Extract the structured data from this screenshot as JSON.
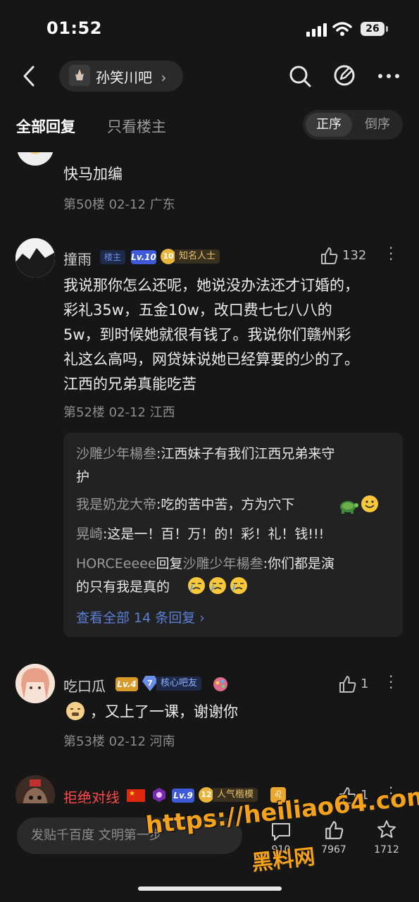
{
  "status_bar": {
    "time": "01:52",
    "battery": "26"
  },
  "nav": {
    "forum_name": "孙笑川吧",
    "chevron": "›"
  },
  "tabs": {
    "all": "全部回复",
    "op_only": "只看楼主",
    "sort_asc": "正序",
    "sort_desc": "倒序"
  },
  "posts": [
    {
      "text": "快马加编",
      "meta": "第50楼 02-12 广东"
    },
    {
      "name": "撞雨",
      "badges": {
        "role": "楼主",
        "level": "Lv.10",
        "title_num": "10",
        "title": "知名人士"
      },
      "likes": "132",
      "lines": [
        "我说那你怎么还呢，她说没办法还才订婚的，",
        "彩礼35w，五金10w，改口费七七八八的",
        "5w，到时候她就很有钱了。我说你们赣州彩",
        "礼这么高吗，网贷妹说她已经算要的少的了。",
        "江西的兄弟真能吃苦"
      ],
      "meta": "第52楼 02-12 江西",
      "replies": [
        {
          "who": "沙雕少年楊叁",
          "text1": ":江西妹子有我们江西兄弟来守",
          "text2": "护"
        },
        {
          "who": "我是奶龙大帝",
          "text1": ":吃的苦中苦，方为穴下"
        },
        {
          "who": "晃崎",
          "text1": ":这是一！百！万！的！彩！礼！钱!!!"
        },
        {
          "who": "HORCEeeee",
          "reply": "回复",
          "to": "沙雕少年楊叁",
          "text1": ":你们都是演",
          "text2": "的只有我是真的"
        }
      ],
      "view_all": "查看全部 14 条回复 ›"
    },
    {
      "name": "吃口瓜",
      "badges": {
        "level": "Lv.4",
        "title_num": "7",
        "title": "核心吧友"
      },
      "likes": "1",
      "text": "，又上了一课，谢谢你",
      "meta": "第53楼 02-12 河南"
    },
    {
      "name": "拒绝对线",
      "badges": {
        "level": "Lv.9",
        "title_num": "12",
        "title": "人气楷模"
      },
      "likes": "1"
    }
  ],
  "bottom_bar": {
    "input_placeholder": "发贴千百度 文明第一步",
    "comments": "910",
    "likes": "7967",
    "favorites": "1712"
  },
  "watermark": {
    "url": "https://heiliao64.com",
    "name": "黑料网"
  },
  "colors": {
    "background": "#161616",
    "link": "#5b7fd6",
    "watermark": "#f4a21a",
    "username_red": "#ff4a4a"
  }
}
